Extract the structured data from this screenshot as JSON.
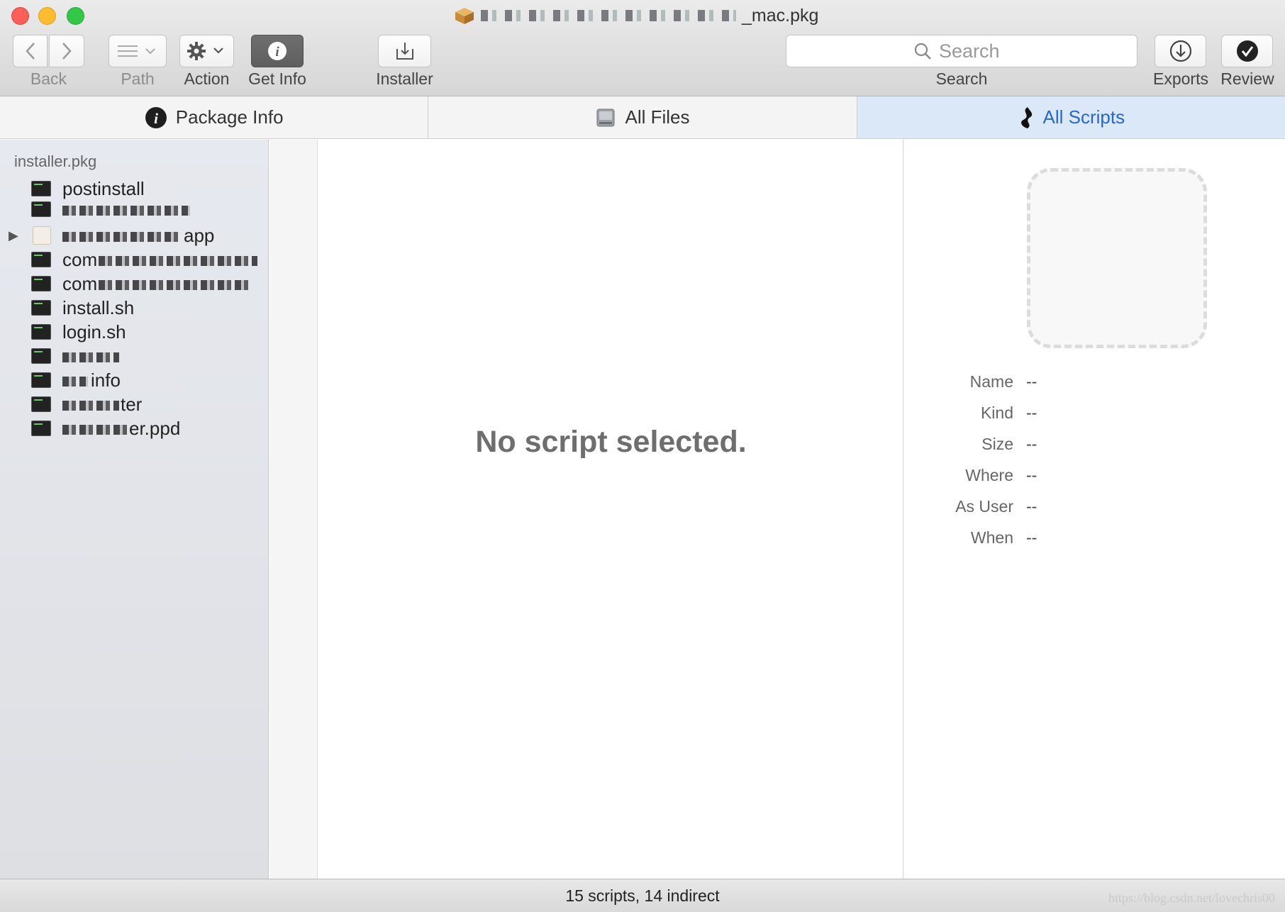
{
  "window": {
    "title_suffix": "_mac.pkg"
  },
  "toolbar": {
    "back_label": "Back",
    "path_label": "Path",
    "action_label": "Action",
    "getinfo_label": "Get Info",
    "installer_label": "Installer",
    "search_placeholder": "Search",
    "search_label": "Search",
    "exports_label": "Exports",
    "review_label": "Review"
  },
  "tabs": [
    {
      "label": "Package Info",
      "icon": "info-icon",
      "active": false
    },
    {
      "label": "All Files",
      "icon": "disk-icon",
      "active": false
    },
    {
      "label": "All Scripts",
      "icon": "script-icon",
      "active": true
    }
  ],
  "sidebar": {
    "title": "installer.pkg",
    "items": [
      {
        "label": "postinstall"
      },
      {
        "label": ""
      },
      {
        "label": "app",
        "kind": "application",
        "disclosure": true
      },
      {
        "label": "com"
      },
      {
        "label": "com"
      },
      {
        "label": "install.sh"
      },
      {
        "label": "login.sh"
      },
      {
        "label": ""
      },
      {
        "label": "info"
      },
      {
        "label": "ter"
      },
      {
        "label": "er.ppd"
      }
    ]
  },
  "main": {
    "empty_message": "No script selected."
  },
  "inspector": {
    "rows": [
      {
        "label": "Name",
        "value": "--"
      },
      {
        "label": "Kind",
        "value": "--"
      },
      {
        "label": "Size",
        "value": "--"
      },
      {
        "label": "Where",
        "value": "--"
      },
      {
        "label": "As User",
        "value": "--"
      },
      {
        "label": "When",
        "value": "--"
      }
    ]
  },
  "status": {
    "text": "15 scripts, 14 indirect",
    "watermark": "https://blog.csdn.net/lovechris00"
  },
  "colors": {
    "accent": "#2568d0",
    "active_tab_bg": "#dbe8f8"
  }
}
